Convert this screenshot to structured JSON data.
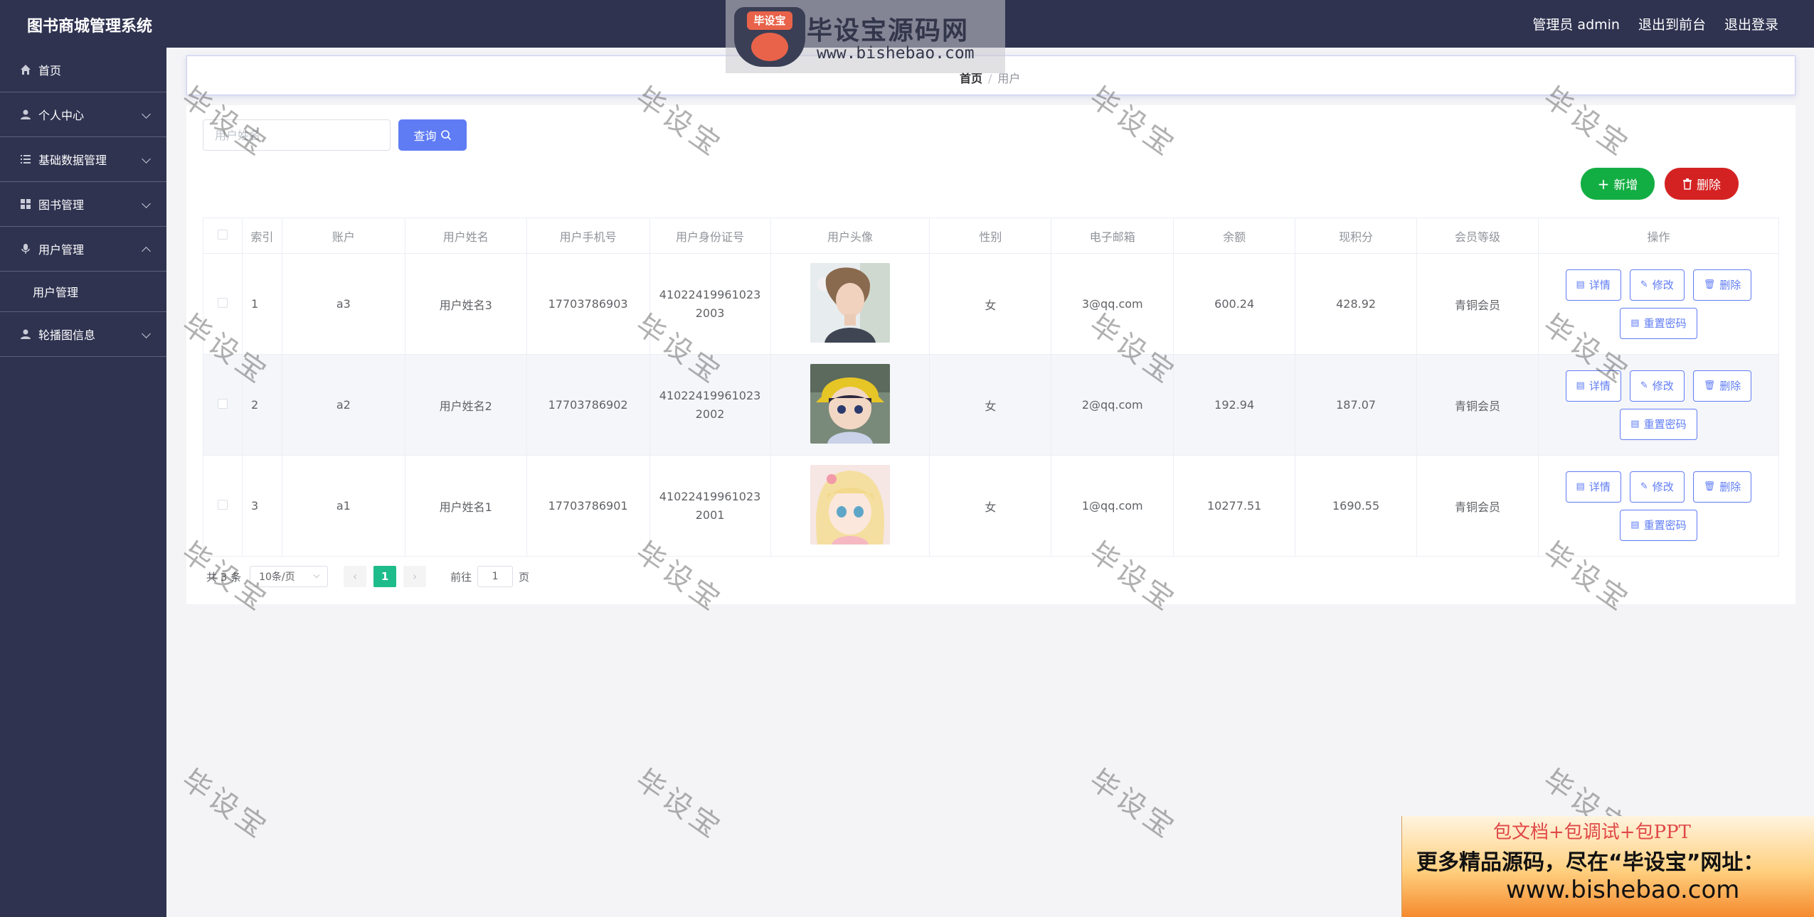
{
  "app": {
    "title": "图书商城管理系统",
    "admin_label": "管理员 admin",
    "to_front_label": "退出到前台",
    "logout_label": "退出登录"
  },
  "watermark": {
    "logo_badge": "毕设宝",
    "logo_brand": "毕设宝源码网",
    "logo_url": "www.bishebao.com",
    "diagonal_text": "毕设宝"
  },
  "sidebar": {
    "items": [
      {
        "label": "首页",
        "icon": "home-icon"
      },
      {
        "label": "个人中心",
        "icon": "user-icon"
      },
      {
        "label": "基础数据管理",
        "icon": "list-icon"
      },
      {
        "label": "图书管理",
        "icon": "grid-icon"
      },
      {
        "label": "用户管理",
        "icon": "mic-icon"
      },
      {
        "label": "轮播图信息",
        "icon": "user-icon"
      }
    ],
    "subitem": "用户管理"
  },
  "breadcrumb": {
    "home": "首页",
    "separator": "/",
    "current": "用户"
  },
  "search": {
    "placeholder": "用户姓名",
    "button_label": "查询"
  },
  "actions": {
    "add_label": "新增",
    "delete_label": "删除"
  },
  "table": {
    "headers": [
      "索引",
      "账户",
      "用户姓名",
      "用户手机号",
      "用户身份证号",
      "用户头像",
      "性别",
      "电子邮箱",
      "余额",
      "现积分",
      "会员等级",
      "操作"
    ],
    "rows": [
      {
        "index": "1",
        "account": "a3",
        "name": "用户姓名3",
        "phone": "17703786903",
        "id_card": "410224199610232003",
        "gender": "女",
        "email": "3@qq.com",
        "balance": "600.24",
        "points": "428.92",
        "level": "青铜会员"
      },
      {
        "index": "2",
        "account": "a2",
        "name": "用户姓名2",
        "phone": "17703786902",
        "id_card": "410224199610232002",
        "gender": "女",
        "email": "2@qq.com",
        "balance": "192.94",
        "points": "187.07",
        "level": "青铜会员"
      },
      {
        "index": "3",
        "account": "a1",
        "name": "用户姓名1",
        "phone": "17703786901",
        "id_card": "410224199610232001",
        "gender": "女",
        "email": "1@qq.com",
        "balance": "10277.51",
        "points": "1690.55",
        "level": "青铜会员"
      }
    ],
    "ops": {
      "detail": "详情",
      "edit": "修改",
      "delete": "删除",
      "reset": "重置密码"
    }
  },
  "pager": {
    "total": "共 3 条",
    "page_size": "10条/页",
    "current_page": "1",
    "goto_prefix": "前往",
    "goto_value": "1",
    "goto_suffix": "页"
  },
  "ad": {
    "line1": "包文档+包调试+包PPT",
    "line2": "更多精品源码，尽在“毕设宝”网址：",
    "line3": "www.bishebao.com"
  },
  "colors": {
    "sidebar_bg": "#2f3350",
    "primary": "#5f7cf4",
    "success": "#13ae43",
    "danger": "#d42222",
    "page_active": "#1ebc8a"
  }
}
